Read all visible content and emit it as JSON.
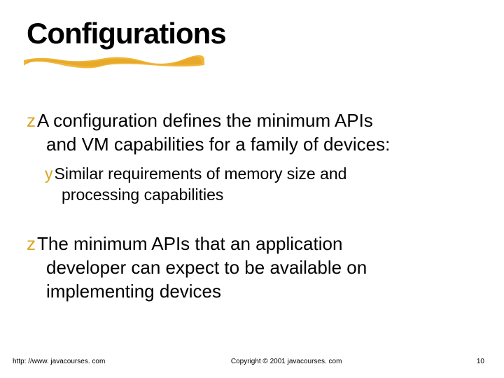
{
  "title": "Configurations",
  "bullets": {
    "b1": {
      "line1": "A configuration defines the minimum APIs",
      "line2": "and VM capabilities for a family of devices:"
    },
    "b1_sub": {
      "line1": "Similar requirements of memory size and",
      "line2": "processing capabilities"
    },
    "b2": {
      "line1": "The minimum APIs that an application",
      "line2": "developer can expect to be available on",
      "line3": "implementing devices"
    }
  },
  "footer": {
    "url": "http: //www. javacourses. com",
    "copyright": "Copyright © 2001 javacourses. com",
    "page": "10"
  },
  "colors": {
    "accent": "#DAA520",
    "accentLight": "#F4C542"
  }
}
